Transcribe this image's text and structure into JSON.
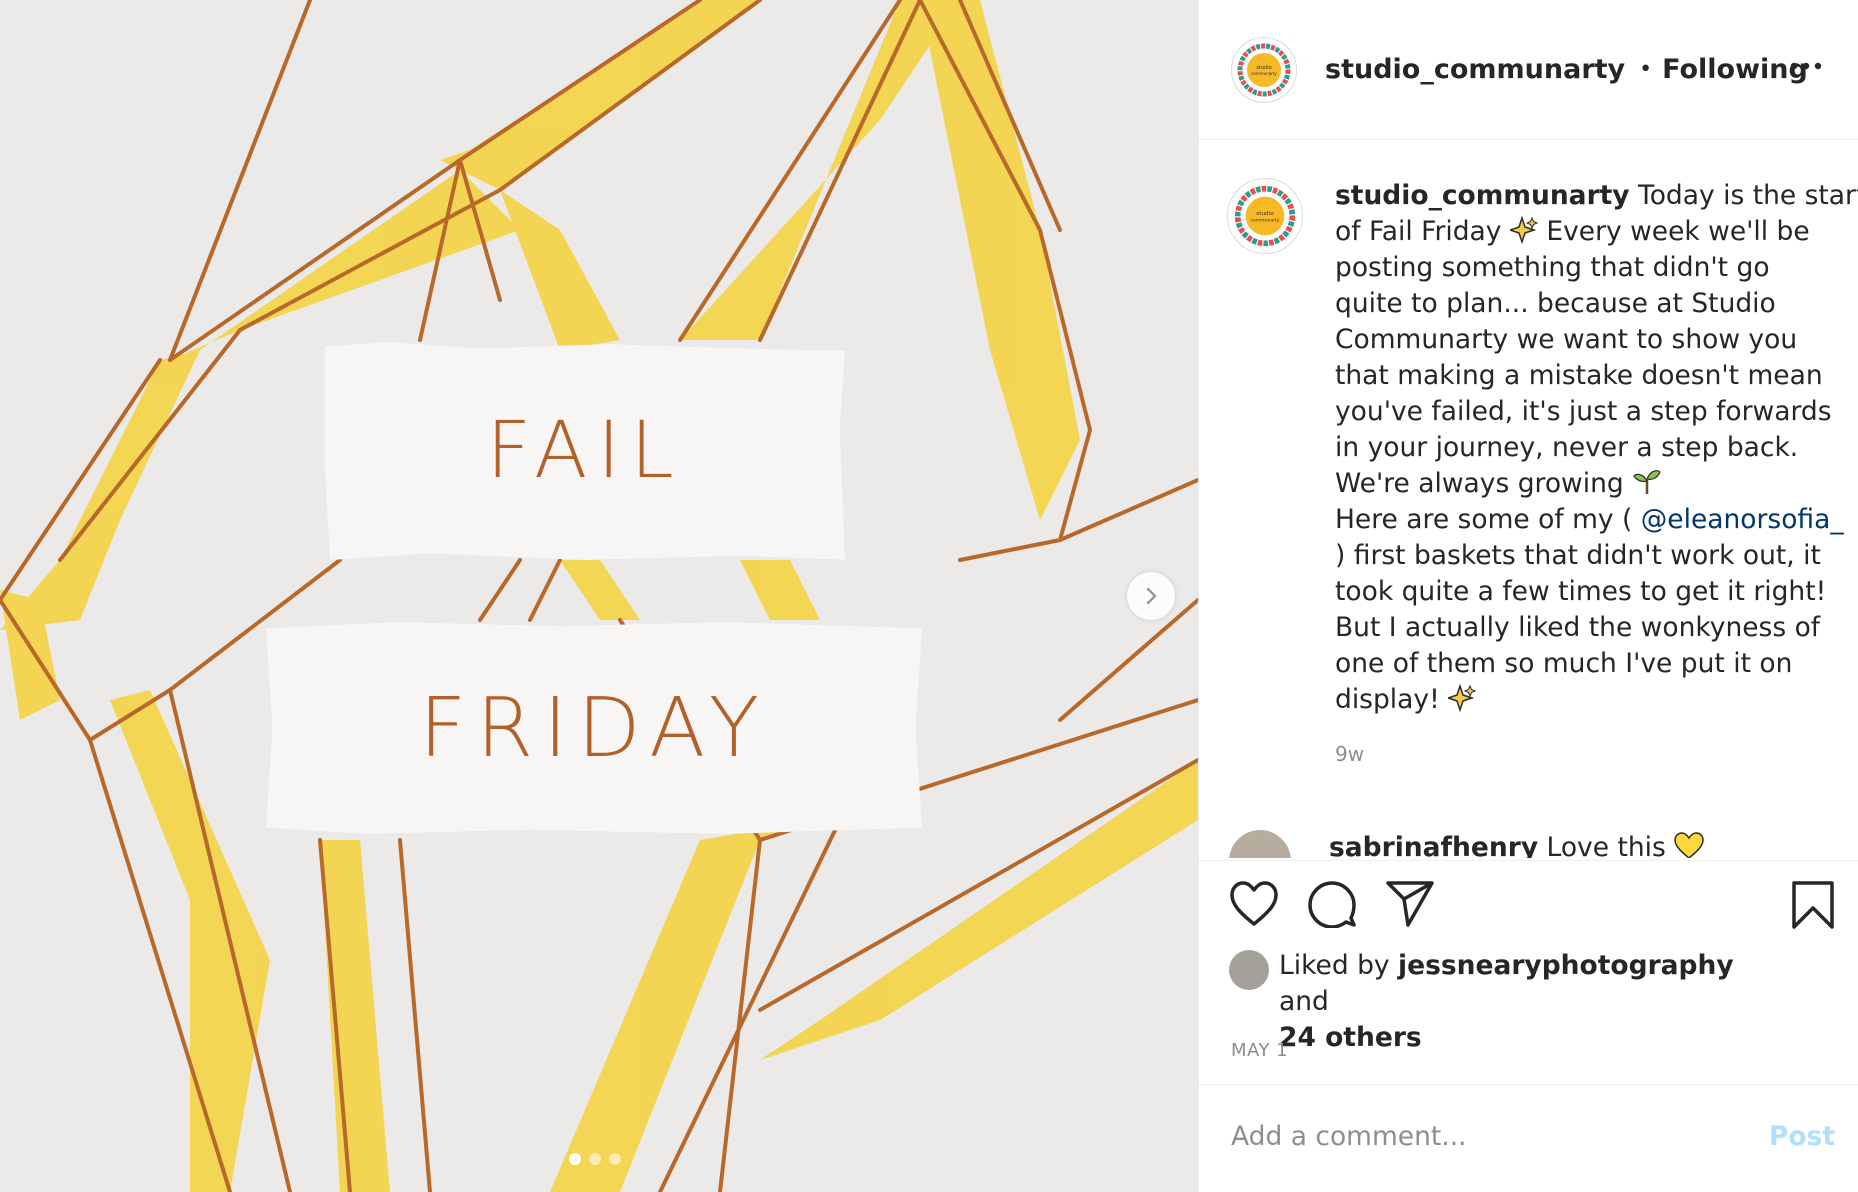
{
  "post": {
    "media": {
      "label_top": "FAIL",
      "label_bottom": "FRIDAY",
      "carousel_total": 3,
      "carousel_active": 1
    },
    "header": {
      "username": "studio_communarty",
      "separator": "•",
      "follow_status": "Following",
      "more_icon": "more-horizontal-icon"
    },
    "caption": {
      "username": "studio_communarty",
      "lines": [
        "Today is the start",
        "of Fail Friday",
        "Every week we'll be",
        "posting something that didn't go",
        "quite to plan... because at Studio",
        "Communarty we want to show you",
        "that making a mistake doesn't mean",
        "you've failed, it's just a step forwards",
        "in your journey, never a step back.",
        "We're always growing",
        "Here are some of my (",
        ") first baskets that didn't work out, it",
        "took quite a few times to get it right!",
        "But I actually liked the wonkyness of",
        "one of them so much I've put it on",
        "display!"
      ],
      "mention": "@eleanorsofia_",
      "time_ago": "9w",
      "emoji": [
        "sparkles-icon",
        "seedling-icon",
        "sparkles-icon"
      ]
    },
    "comment_peek": {
      "username": "sabrinafhenry",
      "text": "Love this",
      "emoji": "yellow-heart-icon"
    },
    "actions": {
      "like_icon": "heart-icon",
      "comment_icon": "comment-icon",
      "share_icon": "paper-plane-icon",
      "save_icon": "bookmark-icon"
    },
    "likes": {
      "prefix": "Liked by",
      "user": "jessnearyphotography",
      "conj": "and",
      "others": "24 others"
    },
    "date": "MAY 1",
    "comment_box": {
      "placeholder": "Add a comment...",
      "post_label": "Post"
    },
    "colors": {
      "link": "#00376b",
      "post_disabled": "#b2dffc",
      "secondary_text": "#8e8e8e",
      "line_brown": "#b8692a",
      "fill_yellow": "#f5d23a"
    }
  }
}
